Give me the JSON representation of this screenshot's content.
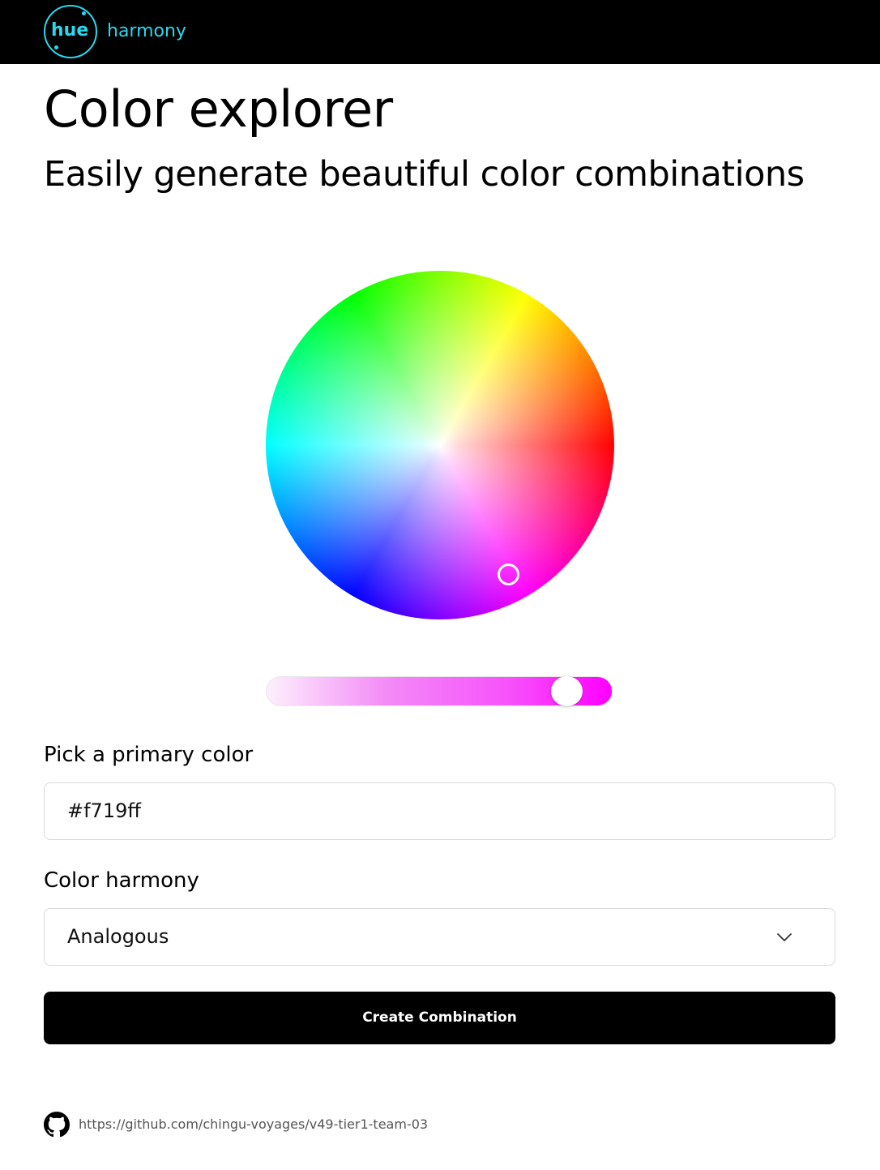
{
  "header": {
    "logo_hue": "hue",
    "logo_harmony": "harmony",
    "brand_color": "#2ad8ec"
  },
  "main": {
    "title": "Color explorer",
    "subtitle": "Easily generate beautiful color combinations",
    "color_wheel": {
      "selected_color": "#f719ff"
    },
    "lightness_slider": {
      "value_fraction": 0.87
    },
    "primary_label": "Pick a primary color",
    "primary_value": "#f719ff",
    "harmony_label": "Color harmony",
    "harmony_selected": "Analogous",
    "create_button": "Create Combination"
  },
  "footer": {
    "github_icon": "github-icon",
    "link_text": "https://github.com/chingu-voyages/v49-tier1-team-03"
  }
}
